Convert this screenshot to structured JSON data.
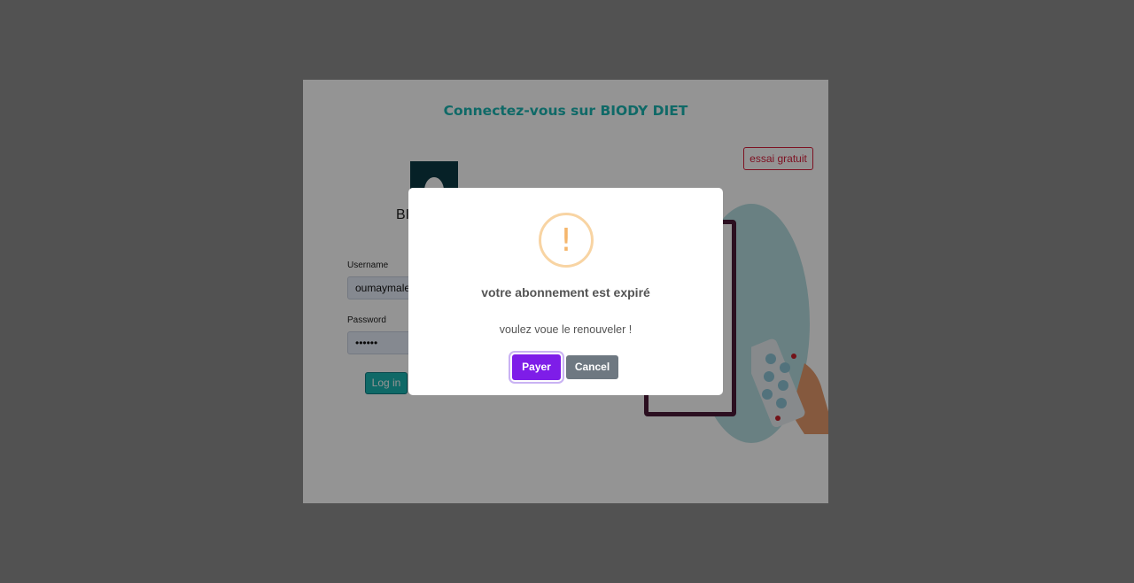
{
  "login": {
    "title": "Connectez-vous sur BIODY DIET",
    "trial_button": "essai gratuit",
    "brand_partial": "BI",
    "username_label": "Username",
    "username_value": "oumaymalej",
    "password_label": "Password",
    "password_value": "••••••",
    "login_button": "Log in"
  },
  "modal": {
    "title": "votre abonnement est expiré",
    "message": "voulez voue le renouveler !",
    "icon": "warning-icon",
    "icon_glyph": "!",
    "pay_button": "Payer",
    "cancel_button": "Cancel"
  },
  "colors": {
    "accent": "#1ab5b1",
    "trial": "#d81f3c",
    "pay": "#7e1de8",
    "cancel": "#6e7881",
    "warning": "#f5b66c"
  }
}
